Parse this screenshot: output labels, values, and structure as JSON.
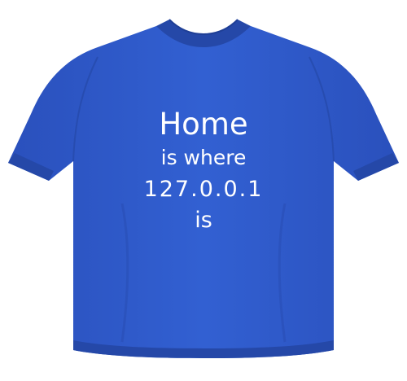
{
  "product": {
    "shirt_color": "#2f58c8",
    "shirt_shadow": "#2548a8",
    "shirt_highlight": "#3a66d6",
    "print_color": "#ffffff"
  },
  "print_text": {
    "line_1": "Home",
    "line_2": "is where",
    "line_3": "127.0.0.1",
    "line_4": "is"
  }
}
